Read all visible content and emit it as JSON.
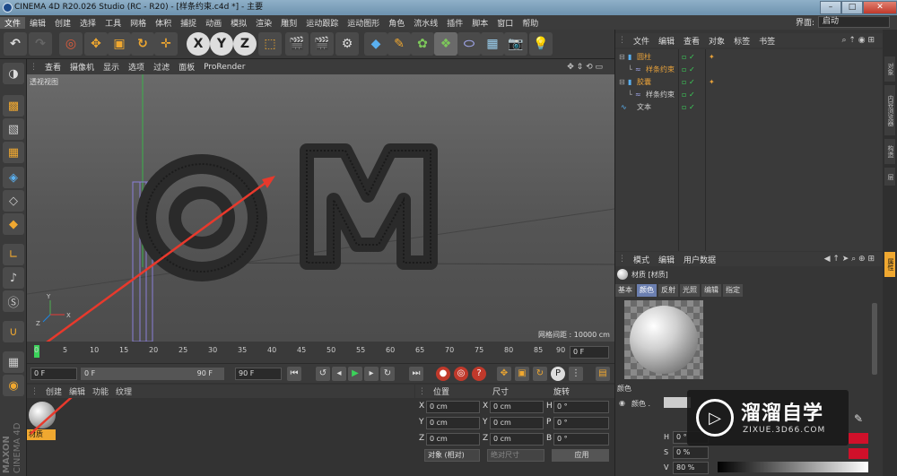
{
  "window": {
    "title": "CINEMA 4D R20.026 Studio (RC - R20) - [样条约束.c4d *] - 主要",
    "min": "–",
    "max": "□",
    "close": "✕"
  },
  "menu": {
    "items": [
      "文件",
      "编辑",
      "创建",
      "选择",
      "工具",
      "网格",
      "体积",
      "捕捉",
      "动画",
      "模拟",
      "渲染",
      "雕刻",
      "运动跟踪",
      "运动图形",
      "角色",
      "流水线",
      "插件",
      "脚本",
      "窗口",
      "帮助"
    ],
    "interface_label": "界面:",
    "interface_value": "启动"
  },
  "toolbar": {
    "x": "X",
    "y": "Y",
    "z": "Z"
  },
  "viewport": {
    "menu": [
      "查看",
      "摄像机",
      "显示",
      "选项",
      "过滤",
      "面板",
      "ProRender"
    ],
    "label": "透视视图",
    "grid_spacing": "网格间距 : 10000 cm",
    "scene_text": "OM"
  },
  "timeline": {
    "ticks": [
      "0",
      "5",
      "10",
      "15",
      "20",
      "25",
      "30",
      "35",
      "40",
      "45",
      "50",
      "55",
      "60",
      "65",
      "70",
      "75",
      "80",
      "85",
      "90"
    ],
    "frame_field": "0 F"
  },
  "playback": {
    "start": "0 F",
    "current": "0 F",
    "range_end": "90 F",
    "end": "90 F",
    "range_right": "90 F"
  },
  "material_manager": {
    "menu": [
      "创建",
      "编辑",
      "功能",
      "纹理"
    ],
    "material_name": "材质"
  },
  "coordinates": {
    "headers": [
      "位置",
      "尺寸",
      "旋转"
    ],
    "rows": [
      {
        "axis1": "X",
        "pos": "0 cm",
        "axis2": "X",
        "size": "0 cm",
        "axis3": "H",
        "rot": "0 °"
      },
      {
        "axis1": "Y",
        "pos": "0 cm",
        "axis2": "Y",
        "size": "0 cm",
        "axis3": "P",
        "rot": "0 °"
      },
      {
        "axis1": "Z",
        "pos": "0 cm",
        "axis2": "Z",
        "size": "0 cm",
        "axis3": "B",
        "rot": "0 °"
      }
    ],
    "mode": "对象 (相对)",
    "size_mode": "绝对尺寸",
    "apply": "应用"
  },
  "object_manager": {
    "menu": [
      "文件",
      "编辑",
      "查看",
      "对象",
      "标签",
      "书签"
    ],
    "objects": [
      {
        "name": "圆柱",
        "indent": 0,
        "color": "#e8a23a"
      },
      {
        "name": "样条约束",
        "indent": 1,
        "color": "#e8a23a"
      },
      {
        "name": "胶囊",
        "indent": 0,
        "color": "#e8a23a"
      },
      {
        "name": "样条约束",
        "indent": 1,
        "color": "#cfcfcf"
      },
      {
        "name": "文本",
        "indent": 0,
        "color": "#cfcfcf"
      }
    ]
  },
  "attributes": {
    "menu": [
      "模式",
      "编辑",
      "用户数据"
    ],
    "title": "材质 [材质]",
    "tabs": [
      "基本",
      "颜色",
      "反射",
      "光照",
      "编辑",
      "指定"
    ],
    "active_tab": "颜色",
    "section": "颜色",
    "color_label": "颜色 .",
    "h_label": "H",
    "h_value": "0 °",
    "s_label": "S",
    "s_value": "0 %",
    "v_label": "V",
    "v_value": "80 %"
  },
  "side_tabs": [
    "对象",
    "内容浏览器",
    "构造",
    "层"
  ],
  "side_tab_attr": "属性",
  "watermark": {
    "brand": "溜溜自学",
    "url": "ZIXUE.3D66.COM"
  },
  "vertical_brand": {
    "maxon": "MAXON",
    "c4d": "CINEMA 4D"
  }
}
